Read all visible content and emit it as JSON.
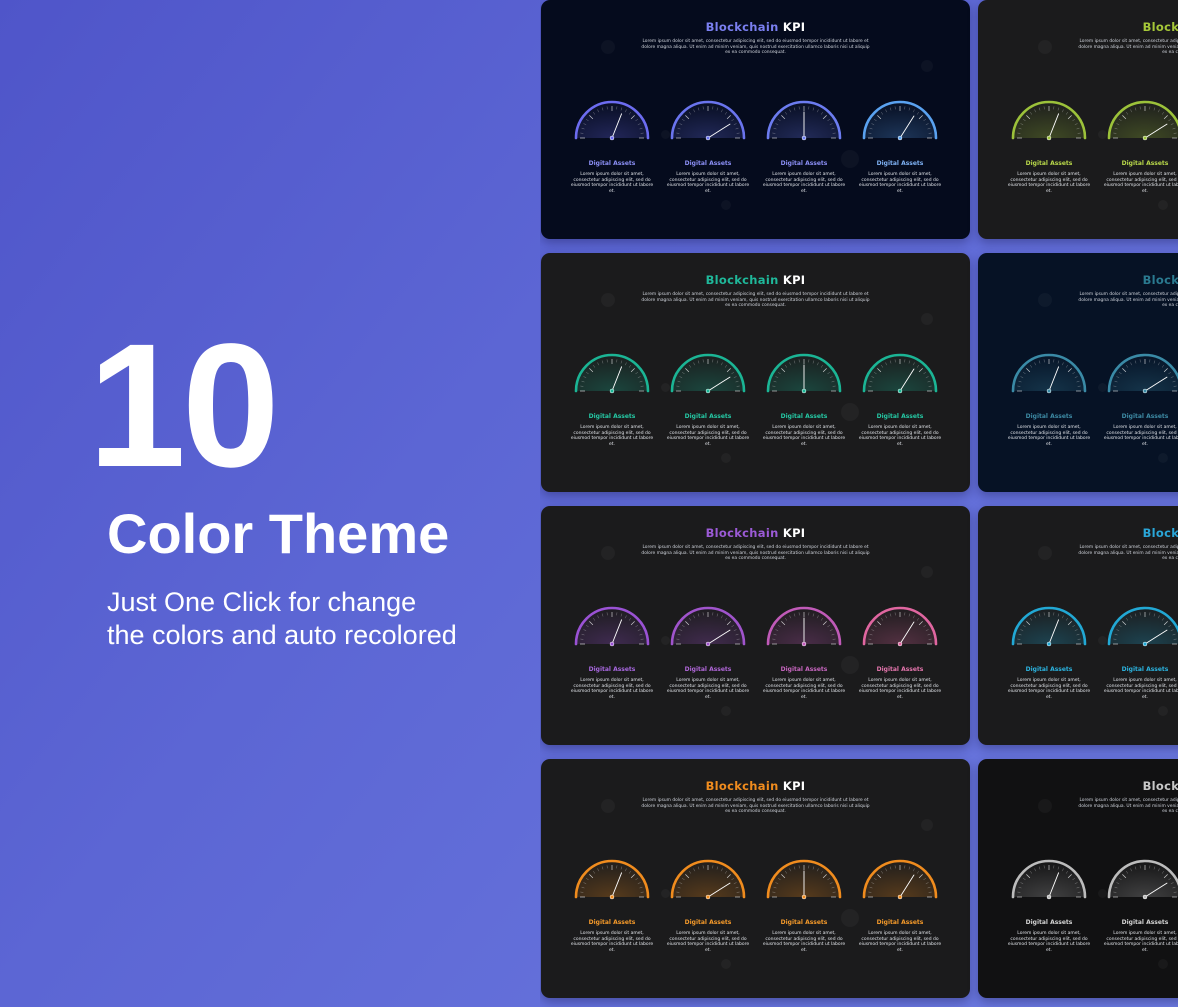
{
  "hero": {
    "number": "10",
    "title": "Color Theme",
    "tagline": "Just One Click for change the colors and auto recolored"
  },
  "slide_content": {
    "title_word": "Blockchain",
    "title_kpi": "KPI",
    "subtitle": "Lorem ipsum dolor sit amet, consectetur adipiscing elit, sed do eiusmod tempor incididunt ut labore et dolore magna aliqua. Ut enim ad minim veniam, quis nostrud exercitation ullamco laboris nisi ut aliquip ex ea commodo consequat.",
    "gauge_label": "Digital Assets",
    "gauge_desc": "Lorem ipsum dolor sit amet, consectetur adipiscing elit, sed do eiusmod tempor incididunt ut labore et.",
    "gauge_levels": [
      0.62,
      0.82,
      0.5,
      0.68
    ]
  },
  "themes": [
    {
      "name": "blue",
      "background": "#050b1d",
      "title_color": "#7a7ff0",
      "gauge_colors": [
        "#6c6cf0",
        "#6a74ee",
        "#6c7cf0",
        "#5aa2f0"
      ],
      "label_colors": [
        "#8b8ff5",
        "#8b8ff5",
        "#8b8ff5",
        "#7fb2f5"
      ]
    },
    {
      "name": "lime",
      "background": "#1b1b1c",
      "title_color": "#a6c838",
      "gauge_colors": [
        "#9cc23a",
        "#9cc23a"
      ],
      "label_colors": [
        "#b8d84a",
        "#b8d84a"
      ]
    },
    {
      "name": "teal",
      "background": "#1b1b1c",
      "title_color": "#1fb89a",
      "gauge_colors": [
        "#1bb595",
        "#1bb595",
        "#1bb595",
        "#1bb595"
      ],
      "label_colors": [
        "#25c8a4",
        "#25c8a4",
        "#25c8a4",
        "#25c8a4"
      ]
    },
    {
      "name": "dark-teal",
      "background": "#061225",
      "title_color": "#2a7a90",
      "gauge_colors": [
        "#3a8aa6",
        "#3a8aa6"
      ],
      "label_colors": [
        "#3d8aa4",
        "#3d8aa4"
      ]
    },
    {
      "name": "purple",
      "background": "#1b1b1c",
      "title_color": "#9b5ad6",
      "gauge_colors": [
        "#9a52d4",
        "#a054cc",
        "#c05ab8",
        "#e066a0"
      ],
      "label_colors": [
        "#a868e0",
        "#b066d8",
        "#c866c0",
        "#e676ae"
      ]
    },
    {
      "name": "sky",
      "background": "#1b1b1c",
      "title_color": "#2aa6d8",
      "gauge_colors": [
        "#22a8d4",
        "#22a8d4"
      ],
      "label_colors": [
        "#2bb4e0",
        "#2bb4e0"
      ]
    },
    {
      "name": "orange",
      "background": "#1b1b1c",
      "title_color": "#f08c1e",
      "gauge_colors": [
        "#f08c1e",
        "#f08c1e",
        "#f08c1e",
        "#f08c1e"
      ],
      "label_colors": [
        "#f59a2a",
        "#f59a2a",
        "#f59a2a",
        "#f59a2a"
      ]
    },
    {
      "name": "grey",
      "background": "#111112",
      "title_color": "#c8c8c8",
      "gauge_colors": [
        "#bcbcbc",
        "#bcbcbc"
      ],
      "label_colors": [
        "#d4d4d4",
        "#d4d4d4"
      ]
    }
  ]
}
